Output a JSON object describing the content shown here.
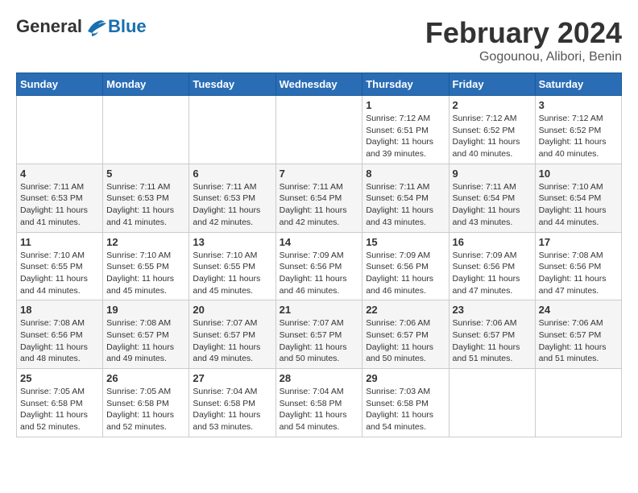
{
  "logo": {
    "general": "General",
    "blue": "Blue"
  },
  "title": "February 2024",
  "location": "Gogounou, Alibori, Benin",
  "days_header": [
    "Sunday",
    "Monday",
    "Tuesday",
    "Wednesday",
    "Thursday",
    "Friday",
    "Saturday"
  ],
  "weeks": [
    [
      {
        "day": "",
        "info": ""
      },
      {
        "day": "",
        "info": ""
      },
      {
        "day": "",
        "info": ""
      },
      {
        "day": "",
        "info": ""
      },
      {
        "day": "1",
        "info": "Sunrise: 7:12 AM\nSunset: 6:51 PM\nDaylight: 11 hours and 39 minutes."
      },
      {
        "day": "2",
        "info": "Sunrise: 7:12 AM\nSunset: 6:52 PM\nDaylight: 11 hours and 40 minutes."
      },
      {
        "day": "3",
        "info": "Sunrise: 7:12 AM\nSunset: 6:52 PM\nDaylight: 11 hours and 40 minutes."
      }
    ],
    [
      {
        "day": "4",
        "info": "Sunrise: 7:11 AM\nSunset: 6:53 PM\nDaylight: 11 hours and 41 minutes."
      },
      {
        "day": "5",
        "info": "Sunrise: 7:11 AM\nSunset: 6:53 PM\nDaylight: 11 hours and 41 minutes."
      },
      {
        "day": "6",
        "info": "Sunrise: 7:11 AM\nSunset: 6:53 PM\nDaylight: 11 hours and 42 minutes."
      },
      {
        "day": "7",
        "info": "Sunrise: 7:11 AM\nSunset: 6:54 PM\nDaylight: 11 hours and 42 minutes."
      },
      {
        "day": "8",
        "info": "Sunrise: 7:11 AM\nSunset: 6:54 PM\nDaylight: 11 hours and 43 minutes."
      },
      {
        "day": "9",
        "info": "Sunrise: 7:11 AM\nSunset: 6:54 PM\nDaylight: 11 hours and 43 minutes."
      },
      {
        "day": "10",
        "info": "Sunrise: 7:10 AM\nSunset: 6:54 PM\nDaylight: 11 hours and 44 minutes."
      }
    ],
    [
      {
        "day": "11",
        "info": "Sunrise: 7:10 AM\nSunset: 6:55 PM\nDaylight: 11 hours and 44 minutes."
      },
      {
        "day": "12",
        "info": "Sunrise: 7:10 AM\nSunset: 6:55 PM\nDaylight: 11 hours and 45 minutes."
      },
      {
        "day": "13",
        "info": "Sunrise: 7:10 AM\nSunset: 6:55 PM\nDaylight: 11 hours and 45 minutes."
      },
      {
        "day": "14",
        "info": "Sunrise: 7:09 AM\nSunset: 6:56 PM\nDaylight: 11 hours and 46 minutes."
      },
      {
        "day": "15",
        "info": "Sunrise: 7:09 AM\nSunset: 6:56 PM\nDaylight: 11 hours and 46 minutes."
      },
      {
        "day": "16",
        "info": "Sunrise: 7:09 AM\nSunset: 6:56 PM\nDaylight: 11 hours and 47 minutes."
      },
      {
        "day": "17",
        "info": "Sunrise: 7:08 AM\nSunset: 6:56 PM\nDaylight: 11 hours and 47 minutes."
      }
    ],
    [
      {
        "day": "18",
        "info": "Sunrise: 7:08 AM\nSunset: 6:56 PM\nDaylight: 11 hours and 48 minutes."
      },
      {
        "day": "19",
        "info": "Sunrise: 7:08 AM\nSunset: 6:57 PM\nDaylight: 11 hours and 49 minutes."
      },
      {
        "day": "20",
        "info": "Sunrise: 7:07 AM\nSunset: 6:57 PM\nDaylight: 11 hours and 49 minutes."
      },
      {
        "day": "21",
        "info": "Sunrise: 7:07 AM\nSunset: 6:57 PM\nDaylight: 11 hours and 50 minutes."
      },
      {
        "day": "22",
        "info": "Sunrise: 7:06 AM\nSunset: 6:57 PM\nDaylight: 11 hours and 50 minutes."
      },
      {
        "day": "23",
        "info": "Sunrise: 7:06 AM\nSunset: 6:57 PM\nDaylight: 11 hours and 51 minutes."
      },
      {
        "day": "24",
        "info": "Sunrise: 7:06 AM\nSunset: 6:57 PM\nDaylight: 11 hours and 51 minutes."
      }
    ],
    [
      {
        "day": "25",
        "info": "Sunrise: 7:05 AM\nSunset: 6:58 PM\nDaylight: 11 hours and 52 minutes."
      },
      {
        "day": "26",
        "info": "Sunrise: 7:05 AM\nSunset: 6:58 PM\nDaylight: 11 hours and 52 minutes."
      },
      {
        "day": "27",
        "info": "Sunrise: 7:04 AM\nSunset: 6:58 PM\nDaylight: 11 hours and 53 minutes."
      },
      {
        "day": "28",
        "info": "Sunrise: 7:04 AM\nSunset: 6:58 PM\nDaylight: 11 hours and 54 minutes."
      },
      {
        "day": "29",
        "info": "Sunrise: 7:03 AM\nSunset: 6:58 PM\nDaylight: 11 hours and 54 minutes."
      },
      {
        "day": "",
        "info": ""
      },
      {
        "day": "",
        "info": ""
      }
    ]
  ]
}
